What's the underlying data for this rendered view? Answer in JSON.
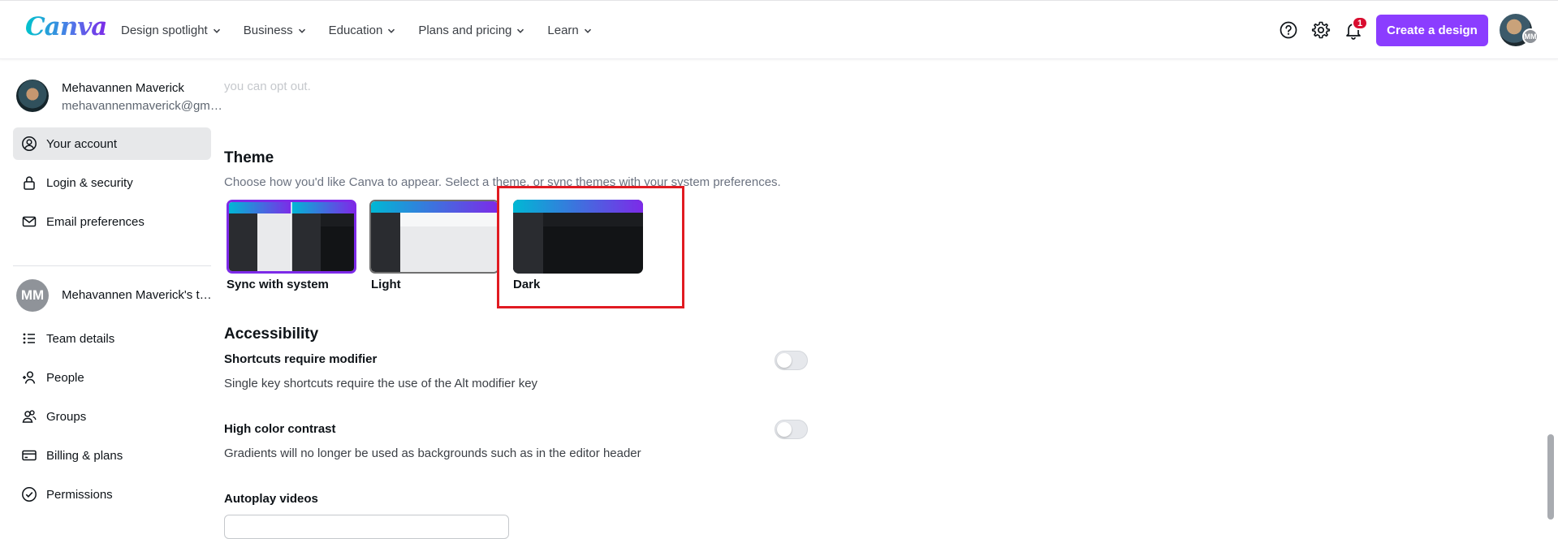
{
  "brand": {
    "logo_text": "Canva",
    "accent": "#8b3dff"
  },
  "nav": {
    "items": [
      {
        "label": "Design spotlight"
      },
      {
        "label": "Business"
      },
      {
        "label": "Education"
      },
      {
        "label": "Plans and pricing"
      },
      {
        "label": "Learn"
      }
    ]
  },
  "header": {
    "notification_count": "1",
    "create_button_label": "Create a design",
    "avatar_initials": "MM"
  },
  "sidebar": {
    "user_name": "Mehavannen Maverick",
    "user_email": "mehavannenmaverick@gmail.com",
    "items": [
      {
        "label": "Your account",
        "icon": "user-circle-icon",
        "active": true
      },
      {
        "label": "Login & security",
        "icon": "lock-icon"
      },
      {
        "label": "Email preferences",
        "icon": "envelope-icon"
      }
    ],
    "team": {
      "initials": "MM",
      "name": "Mehavannen Maverick's team",
      "items": [
        {
          "label": "Team details",
          "icon": "list-icon"
        },
        {
          "label": "People",
          "icon": "people-add-icon"
        },
        {
          "label": "Groups",
          "icon": "groups-icon"
        },
        {
          "label": "Billing & plans",
          "icon": "credit-card-icon"
        },
        {
          "label": "Permissions",
          "icon": "check-circle-icon"
        }
      ]
    }
  },
  "main": {
    "faded_text": "you can opt out.",
    "theme": {
      "heading": "Theme",
      "description": "Choose how you'd like Canva to appear. Select a theme, or sync themes with your system preferences.",
      "options": [
        {
          "label": "Sync with system",
          "selected": true
        },
        {
          "label": "Light",
          "selected": false
        },
        {
          "label": "Dark",
          "selected": false
        }
      ]
    },
    "accessibility": {
      "heading": "Accessibility",
      "options": [
        {
          "title": "Shortcuts require modifier",
          "description": "Single key shortcuts require the use of the Alt modifier key",
          "enabled": false
        },
        {
          "title": "High color contrast",
          "description": "Gradients will no longer be used as backgrounds such as in the editor header",
          "enabled": false
        },
        {
          "title": "Autoplay videos"
        }
      ]
    }
  }
}
